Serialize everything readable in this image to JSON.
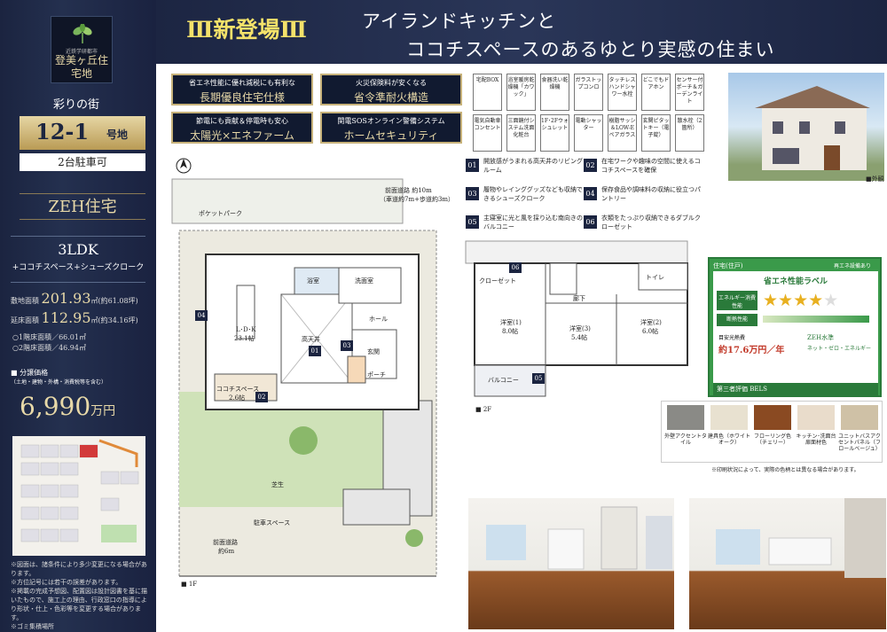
{
  "side": {
    "logo_sub": "近鉄学研都市",
    "logo_name": "登美ヶ丘住宅地",
    "tagline": "彩りの街",
    "lot_no": "12-1",
    "lot_suffix": "号地",
    "parking": "2台駐車可",
    "zeh": "ZEH住宅",
    "layout": "3LDK",
    "layout_sub": "+ココチスペース+シューズクローク",
    "site_label": "敷地面積",
    "site_area": "201.93",
    "site_unit": "㎡(約61.08坪)",
    "floor_label": "延床面積",
    "floor_area": "112.95",
    "floor_unit": "㎡(約34.16坪)",
    "f1": "○1階床面積／66.01㎡",
    "f2": "○2階床面積／46.94㎡",
    "price_label": "■ 分譲価格",
    "price_sub": "（土地・建物・外構・消費税等を含む）",
    "price": "6,990",
    "price_unit": "万円",
    "notes": [
      "※図面は、諸条件により多少変更になる場合があります。",
      "※方位記号には若干の誤差があります。",
      "※掲載の完成予想図、配置図は設計図書を基に描いたもので、施工上の理由、行政窓口の指導により形状・仕上・色彩等を変更する場合があります。",
      "※ゴミ集積場所"
    ]
  },
  "header": {
    "new": "Ⅲ新登場Ⅲ",
    "line1": "アイランドキッチンと",
    "line2": "ココチスペースのあるゆとり実感の住まい"
  },
  "features": [
    {
      "t": "省エネ性能に優れ減税にも有利な",
      "v": "長期優良住宅仕様"
    },
    {
      "t": "火災保険料が安くなる",
      "v": "省令準耐火構造"
    },
    {
      "t": "節電にも貢献＆停電時も安心",
      "v": "太陽光×エネファーム"
    },
    {
      "t": "関電SOSオンライン警備システム",
      "v": "ホームセキュリティ"
    }
  ],
  "specs": [
    "宅配BOX",
    "浴室暖房乾燥機「カワック」",
    "食器洗い乾燥機",
    "ガラストップコンロ",
    "タッチレスハンドシャワー水栓",
    "どこでもドアホン",
    "センサー付ポーチ＆ガーデンライト",
    "電気自動車コンセント",
    "三面鏡付システム洗面化粧台",
    "1F･2Fウォシュレット",
    "電動シャッター",
    "樹脂サッシ＆LOW-Eペアガラス",
    "玄関ピタットキー（電子錠）",
    "散水栓（2箇所）"
  ],
  "points": [
    {
      "n": "01",
      "t": "開放感がうまれる高天井のリビングルーム"
    },
    {
      "n": "02",
      "t": "在宅ワークや趣味の空間に使えるココチスペースを確保"
    },
    {
      "n": "03",
      "t": "履物やレインググッズなども収納できるシューズクローク"
    },
    {
      "n": "04",
      "t": "保存食品や調味料の収納に役立つパントリー"
    },
    {
      "n": "05",
      "t": "主寝室に光と風を採り込む南向きのバルコニー"
    },
    {
      "n": "06",
      "t": "衣類をたっぷり収納できるダブルクローゼット"
    }
  ],
  "plan1f": {
    "road_n": "前面道路 約10m",
    "road_n2": "（車道約7m+歩道約3m）",
    "pocket": "ポケットパーク",
    "ldk": "L･D･K",
    "ldk_size": "23.1帖",
    "bath": "浴室",
    "wash": "洗面室",
    "hall": "ホール",
    "entrance": "玄関",
    "porch": "ポーチ",
    "kokochi": "ココチスペース",
    "kokochi_size": "2.6帖",
    "ceiling": "高天井",
    "lawn": "芝生",
    "parking": "駐車スペース",
    "road_s": "前面道路",
    "road_s2": "約6m",
    "label": "■ 1F"
  },
  "plan2f": {
    "r1": "洋室(1)",
    "r1s": "8.0帖",
    "r2": "洋室(2)",
    "r2s": "6.0帖",
    "r3": "洋室(3)",
    "r3s": "5.4帖",
    "hall": "廊下",
    "toilet": "トイレ",
    "balcony": "バルコニー",
    "closet": "クローゼット",
    "label": "■ 2F"
  },
  "exterior_label": "■外観",
  "bels": {
    "top": "住宅(住戸)",
    "title": "省エネ性能ラベル",
    "energy": "エネルギー消費性能",
    "stars": 4,
    "renew": "再エネ設備あり",
    "heat": "断熱性能",
    "cost_label": "目安光熱費",
    "cost": "約17.6万円／年",
    "zeh": "ZEH水準",
    "zeh2": "ネット・ゼロ・エネルギー",
    "footer": "第三者評価 BELS"
  },
  "materials": [
    {
      "name": "外壁アクセントタイル",
      "c": "#8a8a86"
    },
    {
      "name": "建具色（ホワイトオーク）",
      "c": "#e8e1d0"
    },
    {
      "name": "フローリング色（チェリー）",
      "c": "#8a4a22"
    },
    {
      "name": "キッチン･洗面台扉面材色",
      "c": "#e9dccb"
    },
    {
      "name": "ユニットバスアクセントパネル（フロールベージュ）",
      "c": "#cfc1a6"
    }
  ],
  "mat_note": "※印刷状況によって、実際の色柄とは異なる場合があります。",
  "accent": "#1b2440",
  "gold": "#c7b27a"
}
